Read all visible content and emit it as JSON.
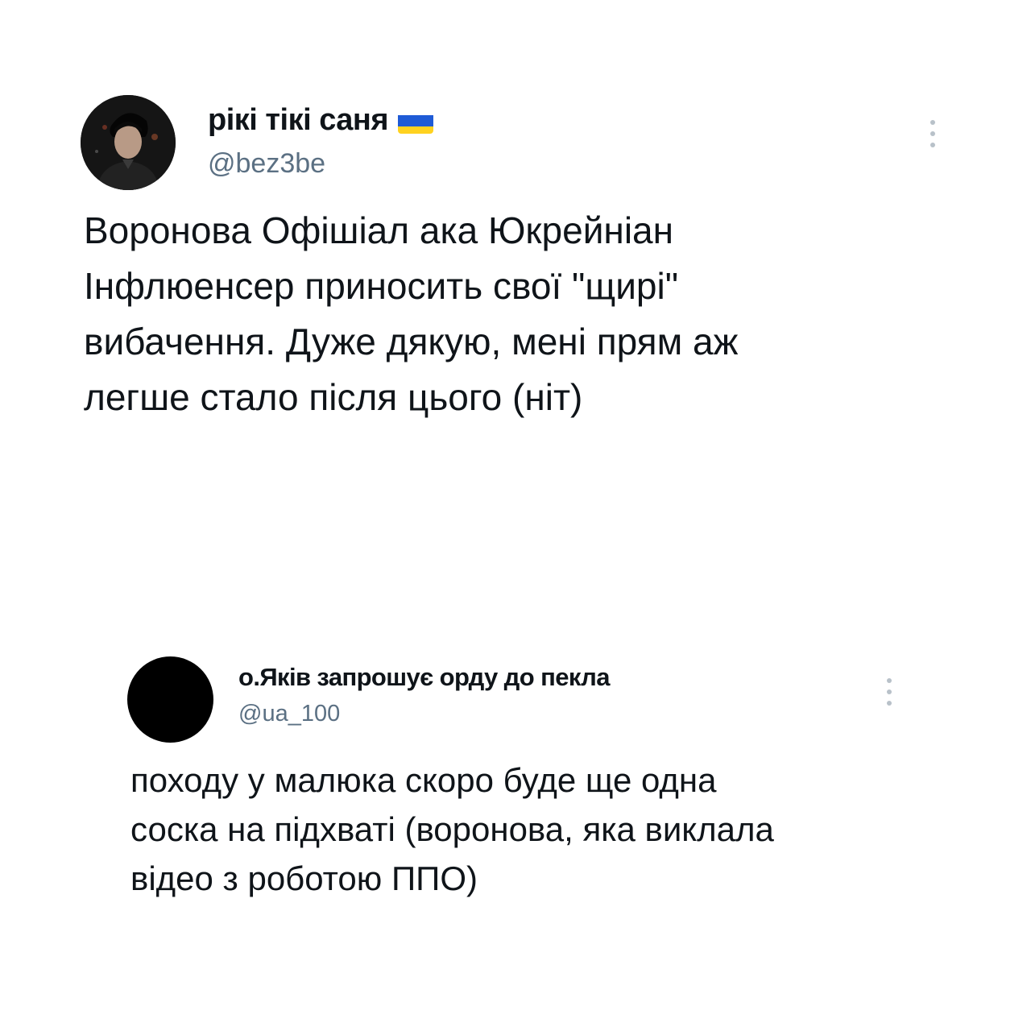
{
  "tweet1": {
    "display_name": "рікі тікі саня",
    "flag_icon": "ukraine-flag-icon",
    "flag_colors": {
      "top": "#1f5bd6",
      "bottom": "#ffd21f"
    },
    "handle": "@bez3be",
    "text_lines": [
      "Воронова Офішіал ака Юкрейніан",
      "Інфлюенсер приносить свої \"щирі\"",
      "вибачення. Дуже дякую, мені прям аж",
      "легше стало після цього (ніт)"
    ],
    "more_icon": "more-options-icon"
  },
  "tweet2": {
    "display_name": "о.Яків запрошує орду до пекла",
    "handle": "@ua_100",
    "text_lines": [
      "походу у малюка скоро буде ще одна",
      "соска на підхваті (воронова, яка виклала",
      "відео з роботою ППО)"
    ],
    "more_icon": "more-options-icon"
  },
  "colors": {
    "text": "#0f1419",
    "secondary": "#5b7083",
    "background": "#ffffff"
  }
}
